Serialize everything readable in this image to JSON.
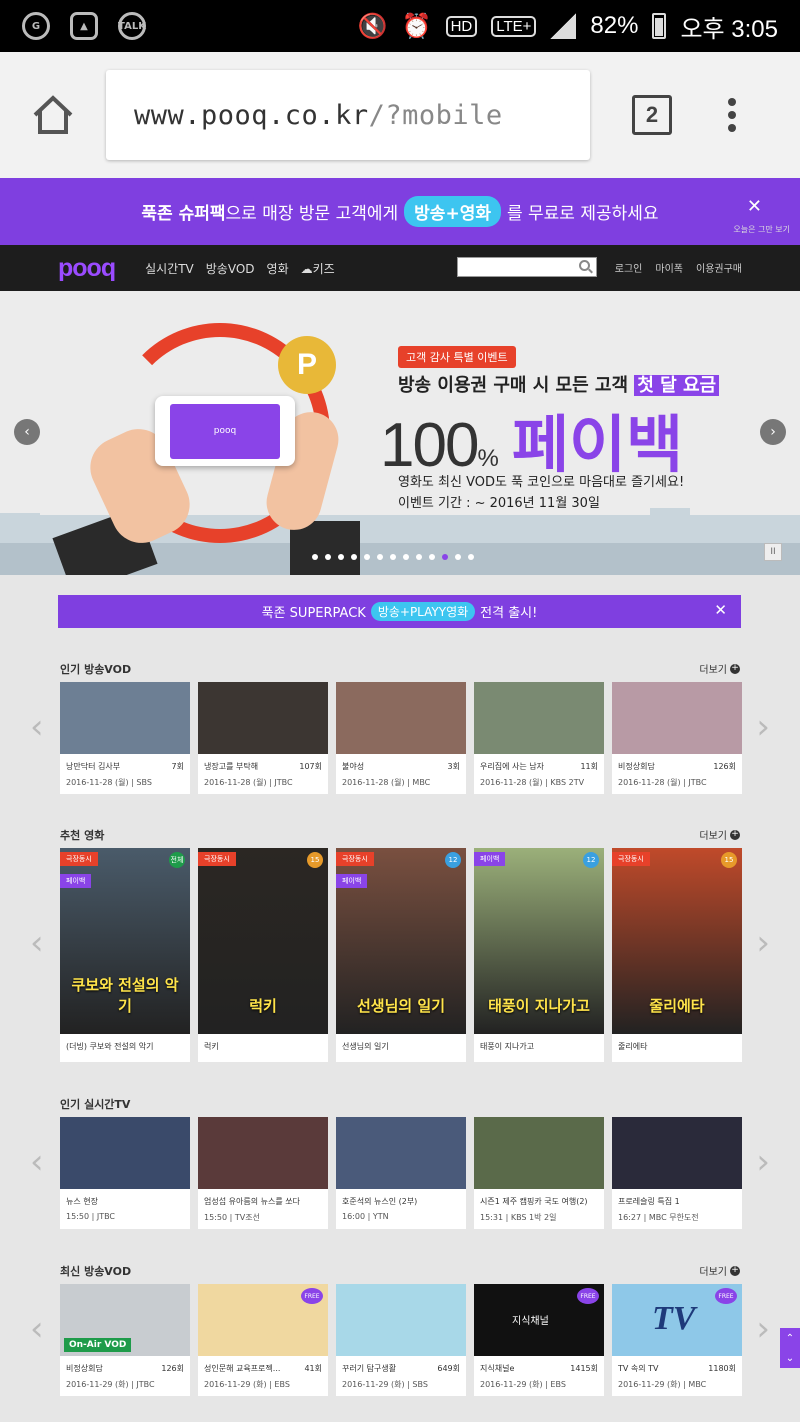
{
  "status_bar": {
    "left_icons": [
      "g-icon",
      "gallery-icon",
      "talk-icon"
    ],
    "talk_label": "TALK",
    "hd": "HD",
    "lte": "LTE+",
    "battery": "82%",
    "time": "오후 3:05"
  },
  "browser": {
    "url_main": "www.pooq.co.kr",
    "url_rest": "/?mobile",
    "tab_count": "2"
  },
  "promo": {
    "text_bold": "푹존 슈퍼팩",
    "text_mid": "으로 매장 방문 고객에게",
    "pill": "방송+영화",
    "text_end": "를 무료로 제공하세요",
    "close": "✕",
    "noshow": "오늘은 그만 보기"
  },
  "nav": {
    "logo": "pooq",
    "items": [
      "실시간TV",
      "방송VOD",
      "영화",
      "키즈"
    ],
    "right": [
      "로그인",
      "마이폭",
      "이용권구매"
    ]
  },
  "banner": {
    "tag": "고객 감사 특별 이벤트",
    "headline": "방송 이용권 구매 시 모든 고객",
    "headline_hl": "첫 달 요금",
    "big": "100",
    "big_pct": "%",
    "big_pay": "페이백",
    "sub": "영화도 최신 VOD도 푹 코인으로 마음대로 즐기세요!",
    "date": "이벤트 기간 : ~ 2016년 11월 30일",
    "phone_logo": "pooq",
    "coin": "P",
    "active_dot": 10,
    "dot_count": 13
  },
  "superpack": {
    "text_a": "푹존 SUPERPACK",
    "pill": "방송+PLAYY영화",
    "text_b": "전격 출시!",
    "close": "✕"
  },
  "sections": {
    "vod": {
      "title": "인기 방송VOD",
      "more": "더보기",
      "items": [
        {
          "title": "낭만닥터 김사부",
          "ep": "7회",
          "date": "2016-11-28 (월) | SBS",
          "color": "#6d7f94"
        },
        {
          "title": "냉장고를 부탁해",
          "ep": "107회",
          "date": "2016-11-28 (월) | JTBC",
          "color": "#3c3632"
        },
        {
          "title": "불야성",
          "ep": "3회",
          "date": "2016-11-28 (월) | MBC",
          "color": "#8b6a5e"
        },
        {
          "title": "우리집에 사는 남자",
          "ep": "11회",
          "date": "2016-11-28 (월) | KBS 2TV",
          "color": "#7a8a72"
        },
        {
          "title": "비정상회담",
          "ep": "126회",
          "date": "2016-11-28 (월) | JTBC",
          "color": "#b89aa5"
        }
      ]
    },
    "movies": {
      "title": "추천 영화",
      "more": "더보기",
      "items": [
        {
          "title": "(더빙) 쿠보와 전설의 악기",
          "tag1": "극장동시",
          "tag2": "페이백",
          "age": "전체",
          "age_color": "#1e9b4a",
          "color": "#4a5b6a",
          "poster": "쿠보와 전설의 악기"
        },
        {
          "title": "럭키",
          "tag1": "극장동시",
          "tag2": "",
          "age": "15",
          "age_color": "#e79a2a",
          "color": "#2b2723",
          "poster": "럭키"
        },
        {
          "title": "선생님의 일기",
          "tag1": "극장동시",
          "tag2": "페이백",
          "age": "12",
          "age_color": "#3aa0e0",
          "color": "#7a5040",
          "poster": "선생님의 일기"
        },
        {
          "title": "태풍이 지나가고",
          "tag1": "페이백",
          "tag2": "",
          "age": "12",
          "age_color": "#3aa0e0",
          "color": "#9bb07a",
          "poster": "태풍이 지나가고"
        },
        {
          "title": "줄리에타",
          "tag1": "극장동시",
          "tag2": "",
          "age": "15",
          "age_color": "#e79a2a",
          "color": "#c04a2a",
          "poster": "줄리에타"
        }
      ]
    },
    "live": {
      "title": "인기 실시간TV",
      "items": [
        {
          "title": "뉴스 현장",
          "sub": "15:50 | JTBC",
          "color": "#3a4a6a"
        },
        {
          "title": "엄성섭 유아름의 뉴스를 쏘다",
          "sub": "15:50 | TV조선",
          "color": "#5a3a3a"
        },
        {
          "title": "호준석의 뉴스인 (2부)",
          "sub": "16:00 | YTN",
          "color": "#4a5a7a"
        },
        {
          "title": "시즌1 제주 캠핑카 국도 여행(2)",
          "sub": "15:31 | KBS 1박 2일",
          "color": "#5a6a4a"
        },
        {
          "title": "프로레슬링 특집 1",
          "sub": "16:27 | MBC 무한도전",
          "color": "#2a2a3a"
        }
      ]
    },
    "newvod": {
      "title": "최신 방송VOD",
      "more": "더보기",
      "items": [
        {
          "title": "비정상회담",
          "ep": "126회",
          "date": "2016-11-29 (화) | JTBC",
          "color": "#c8ccd0",
          "badge": "On-Air VOD",
          "free": ""
        },
        {
          "title": "성인문해 교육프로젝...",
          "ep": "41회",
          "date": "2016-11-29 (화) | EBS",
          "color": "#f0d8a0",
          "badge": "",
          "free": "FREE"
        },
        {
          "title": "꾸러기 탐구생활",
          "ep": "649회",
          "date": "2016-11-29 (화) | SBS",
          "color": "#a8d8e8",
          "badge": "",
          "free": ""
        },
        {
          "title": "지식채널e",
          "ep": "1415회",
          "date": "2016-11-29 (화) | EBS",
          "color": "#111111",
          "badge": "",
          "free": "FREE"
        },
        {
          "title": "TV 속의 TV",
          "ep": "1180회",
          "date": "2016-11-29 (화) | MBC",
          "color": "#8ec8e8",
          "badge": "",
          "free": "FREE"
        }
      ]
    }
  },
  "thumb_text": {
    "knowledge": "지식채널",
    "tv": "TV"
  }
}
